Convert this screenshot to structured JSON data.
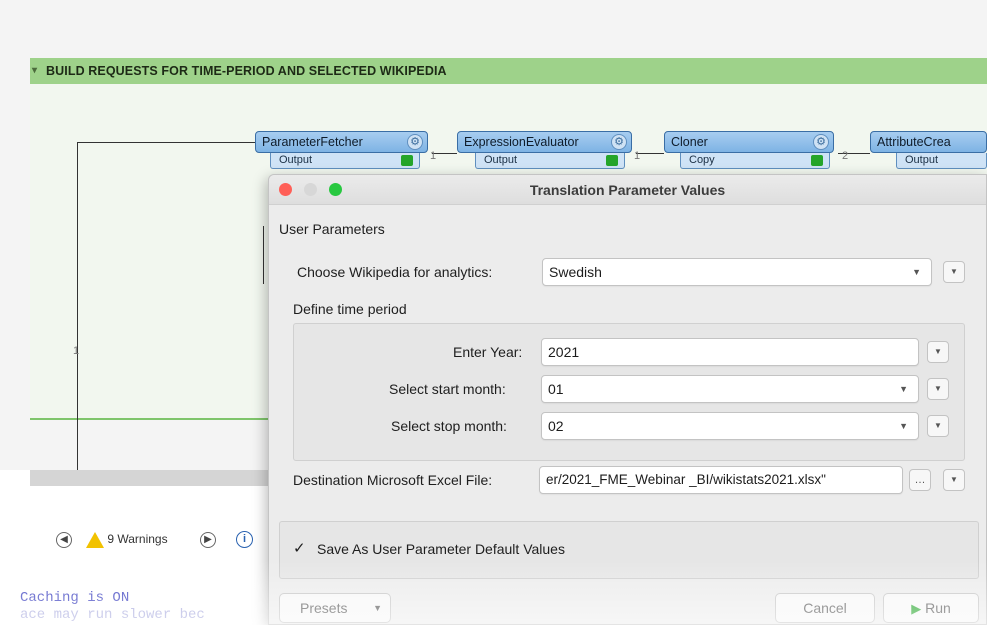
{
  "canvas": {
    "bookmark_title": "BUILD REQUESTS FOR TIME-PERIOD AND SELECTED WIKIPEDIA",
    "transformers": [
      {
        "name": "ParameterFetcher",
        "port": "Output",
        "count": "1"
      },
      {
        "name": "ExpressionEvaluator",
        "port": "Output",
        "count": "1"
      },
      {
        "name": "Cloner",
        "port": "Copy",
        "count": "2"
      },
      {
        "name": "AttributeCrea",
        "port": "Output"
      }
    ],
    "left_connection_count": "1"
  },
  "log": {
    "warnings_label": "9 Warnings",
    "info_label": "i",
    "lines": [
      "Caching is ON",
      "ace may run slower bec"
    ]
  },
  "dialog": {
    "title": "Translation Parameter Values",
    "section_title": "User Parameters",
    "wikipedia": {
      "label": "Choose Wikipedia for analytics:",
      "value": "Swedish"
    },
    "time_period_title": "Define time period",
    "year": {
      "label": "Enter Year:",
      "value": "2021"
    },
    "start_month": {
      "label": "Select start month:",
      "value": "01"
    },
    "stop_month": {
      "label": "Select stop month:",
      "value": "02"
    },
    "destination": {
      "label": "Destination Microsoft Excel File:",
      "value": "er/2021_FME_Webinar _BI/wikistats2021.xlsx\""
    },
    "save_defaults": {
      "label": "Save As User Parameter Default Values",
      "checked": true
    },
    "buttons": {
      "presets": "Presets",
      "cancel": "Cancel",
      "run": "Run"
    }
  },
  "colors": {
    "bookmark_header": "#9ed28a",
    "transformer_blue": "#7eb3e4",
    "close": "#ff5f57",
    "minimize": "#d7d7d7",
    "zoom": "#28c840",
    "run_green": "#25a52a"
  }
}
